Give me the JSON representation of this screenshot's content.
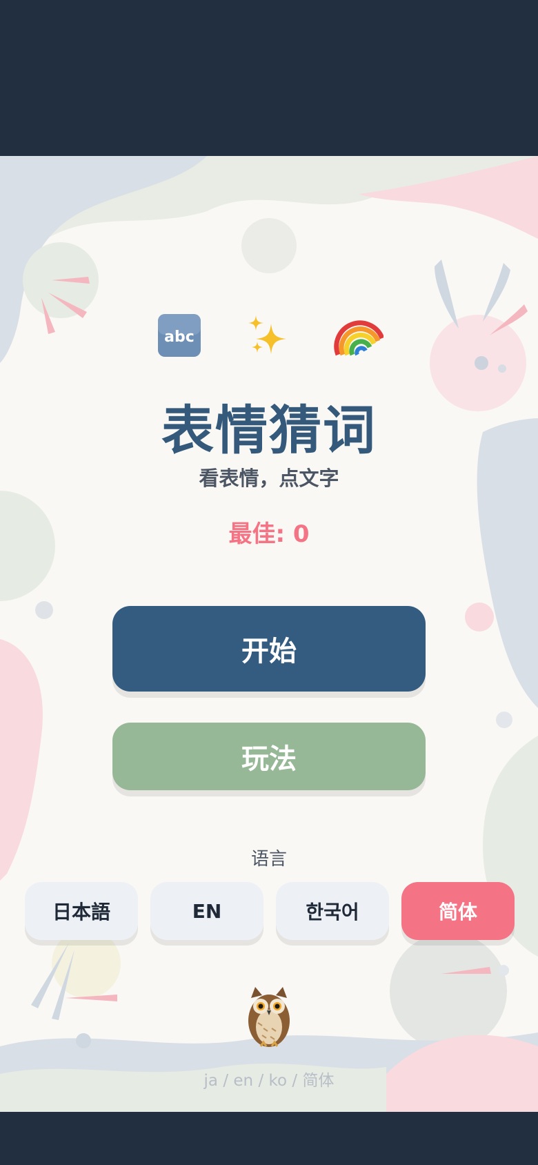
{
  "game": {
    "icons": [
      "abc-emoji-icon",
      "sparkles-emoji-icon",
      "rainbow-emoji-icon"
    ],
    "mascot_icon": "owl-emoji-icon",
    "title": "表情猜词",
    "subtitle": "看表情，点文字",
    "best_label": "最佳: 0",
    "start_label": "开始",
    "howto_label": "玩法",
    "language_label": "语言",
    "languages": [
      {
        "label": "日本語",
        "active": false
      },
      {
        "label": "EN",
        "active": false
      },
      {
        "label": "한국어",
        "active": false
      },
      {
        "label": "简体",
        "active": true
      }
    ],
    "footer": "ja / en / ko / 简体"
  },
  "colors": {
    "frame_bg": "#222f41",
    "page_bg": "#f9f8f4",
    "title": "#34597b",
    "accent_pink": "#f47384",
    "start_button": "#345c80",
    "howto_button": "#97b897",
    "lang_button": "#edf0f4"
  }
}
